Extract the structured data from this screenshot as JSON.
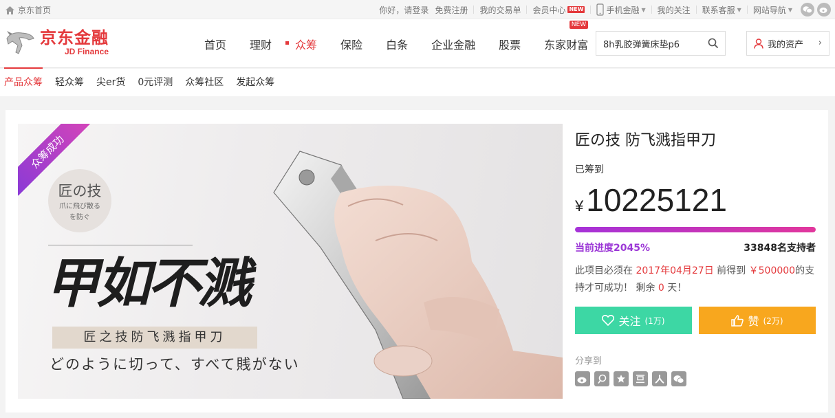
{
  "topbar": {
    "home": "京东首页",
    "greeting": "你好，请登录",
    "register": "免费注册",
    "orders": "我的交易单",
    "member": "会员中心",
    "member_badge": "NEW",
    "mobile": "手机金融",
    "follow": "我的关注",
    "service": "联系客服",
    "sitenav": "网站导航"
  },
  "header": {
    "logo_cn": "京东金融",
    "logo_en": "JD Finance",
    "nav": [
      {
        "label": "首页"
      },
      {
        "label": "理财"
      },
      {
        "label": "众筹",
        "active": true
      },
      {
        "label": "保险"
      },
      {
        "label": "白条"
      },
      {
        "label": "企业金融"
      },
      {
        "label": "股票"
      },
      {
        "label": "东家财富",
        "badge": "NEW"
      }
    ],
    "search_value": "8h乳胶弹簧床垫p6",
    "asset_label": "我的资产"
  },
  "subnav": [
    {
      "label": "产品众筹",
      "active": true
    },
    {
      "label": "轻众筹"
    },
    {
      "label": "尖er货"
    },
    {
      "label": "0元评测"
    },
    {
      "label": "众筹社区"
    },
    {
      "label": "发起众筹"
    }
  ],
  "hero": {
    "ribbon": "众筹成功",
    "seal_title": "匠の技",
    "seal_sub1": "爪に飛び散る",
    "seal_sub2": "を防ぐ",
    "callig": "甲如不溅",
    "tagline": "匠之技防飞溅指甲刀",
    "jp_line": "どのように切って、すべて賎がない"
  },
  "project": {
    "title": "匠の技 防飞溅指甲刀",
    "raised_label": "已筹到",
    "currency": "¥",
    "amount": "10225121",
    "progress_label": "当前进度2045%",
    "progress_fraction": 1.0,
    "supporters": "33848名支持者",
    "desc_pre": "此项目必须在",
    "desc_date": "2017年04月27日",
    "desc_mid": "前得到",
    "desc_goal": "￥500000",
    "desc_post": "的支持才可成功！ 剩余",
    "desc_days": "0",
    "desc_end": "天！",
    "follow_label": "关注",
    "follow_count": "(1万)",
    "like_label": "赞",
    "like_count": "(2万)",
    "share_label": "分享到"
  },
  "colors": {
    "brand_red": "#e4393c",
    "progress_start": "#a532d9",
    "progress_end": "#e2379c",
    "follow_green": "#3dd7a4",
    "like_orange": "#f8a71e"
  }
}
